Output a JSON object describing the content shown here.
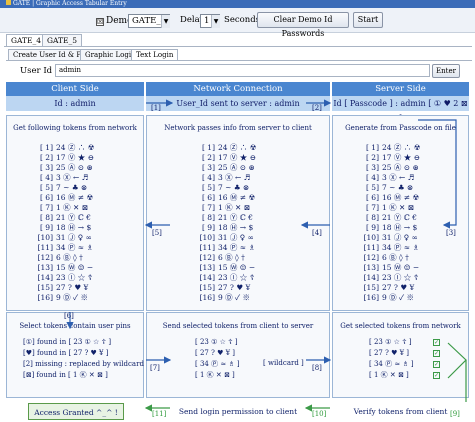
{
  "window": {
    "title": "GATE | Graphic Access Tabular Entry"
  },
  "toolbar": {
    "demo_label": "Demo",
    "demo_checked": "☒",
    "gate_value": "GATE_4",
    "delay_label": "Delay",
    "delay_value": "1",
    "seconds_label": "Seconds",
    "clear_button": "Clear Demo Id Passwords",
    "start_button": "Start",
    "dropdown_glyph": "▼"
  },
  "tabs_top": [
    "GATE_4",
    "GATE_5"
  ],
  "tabs_sub": [
    "Create User Id & Pin",
    "Graphic Login",
    "Text Login"
  ],
  "user": {
    "label": "User Id",
    "value": "admin",
    "enter_button": "Enter"
  },
  "columns": {
    "client": {
      "header": "Client Side",
      "sub": "Id : admin"
    },
    "network": {
      "header": "Network Connection",
      "sub": "User_Id sent to server : admin"
    },
    "server": {
      "header": "Server Side",
      "sub": "Id [ Passcode ] : admin [ ① ♥ 2 ⊠ ]"
    }
  },
  "arrow_labels": {
    "a1": "[1]",
    "a2": "[2]",
    "a3": "[3]",
    "a4": "[4]",
    "a5": "[5]",
    "a6": "[6]",
    "a7": "[7]",
    "a8": "[8]",
    "a9": "[9]",
    "a10": "[10]",
    "a11": "[11]"
  },
  "panels": {
    "client_title": "Get following tokens from network",
    "network_title": "Network passes info from server to client",
    "server_title": "Generate from Passcode on file"
  },
  "tokens": [
    {
      "n": "[ 1]",
      "t": "24 Ⓩ ∴ ☢"
    },
    {
      "n": "[ 2]",
      "t": "17 Ⓥ ★ ⊖"
    },
    {
      "n": "[ 3]",
      "t": "25 Ⓐ ⊙ ⊛"
    },
    {
      "n": "[ 4]",
      "t": "3 Ⓧ ← ♬"
    },
    {
      "n": "[ 5]",
      "t": "7 ~ ♣ ⊗"
    },
    {
      "n": "[ 6]",
      "t": "16 Ⓜ ≠ ☢"
    },
    {
      "n": "[ 7]",
      "t": "1 Ⓚ ✕ ⊠"
    },
    {
      "n": "[ 8]",
      "t": "21 Ⓨ ℂ €"
    },
    {
      "n": "[ 9]",
      "t": "18 Ⓗ → $"
    },
    {
      "n": "[10]",
      "t": "31 Ⓙ ♀ ∞"
    },
    {
      "n": "[11]",
      "t": "34 Ⓟ ≈ ♗"
    },
    {
      "n": "[12]",
      "t": "6 Ⓑ ◊ †"
    },
    {
      "n": "[13]",
      "t": "15 Ⓦ ☺ −"
    },
    {
      "n": "[14]",
      "t": "23 Ⓘ ☆ ☦"
    },
    {
      "n": "[15]",
      "t": "27 ? ♥ ¥"
    },
    {
      "n": "[16]",
      "t": "9 Ⓓ ✓ ※"
    }
  ],
  "bottom": {
    "client_title": "Select tokens contain user pins",
    "client_rows": [
      "[①]   found in [ 23 ① ☆ ☦ ]",
      "[♥]   found in [ 27 ? ♥ ¥ ]",
      "[2]   missing : replaced by wildcard",
      "[⊠]   found in [ 1 Ⓚ ✕ ⊠ ]"
    ],
    "network_title": "Send selected tokens from client to server",
    "network_rows": [
      "[ 23 ① ☆ ☦ ]",
      "[ 27 ? ♥ ¥ ]",
      "[ 34 Ⓟ ≈ ♗ ]",
      "[ 1 Ⓚ ✕ ⊠ ]"
    ],
    "wildcard": "[ wildcard ]",
    "server_title": "Get selected tokens from network",
    "server_rows": [
      "[ 23 ① ☆ ☦ ]",
      "[ 27 ? ♥ ¥ ]",
      "[ 34 Ⓟ ≈ ♗ ]",
      "[ 1 Ⓚ ✕ ⊠ ]"
    ],
    "check": "✓"
  },
  "footer": {
    "granted": "Access Granted  ^_^ !",
    "send_permission": "Send login permission to client",
    "verify": "Verify tokens from client"
  },
  "colors": {
    "header_blue": "#4a86d0",
    "sub_blue": "#bcd6f2",
    "arrow_blue": "#2d5fb0",
    "green": "#3c9a48"
  }
}
